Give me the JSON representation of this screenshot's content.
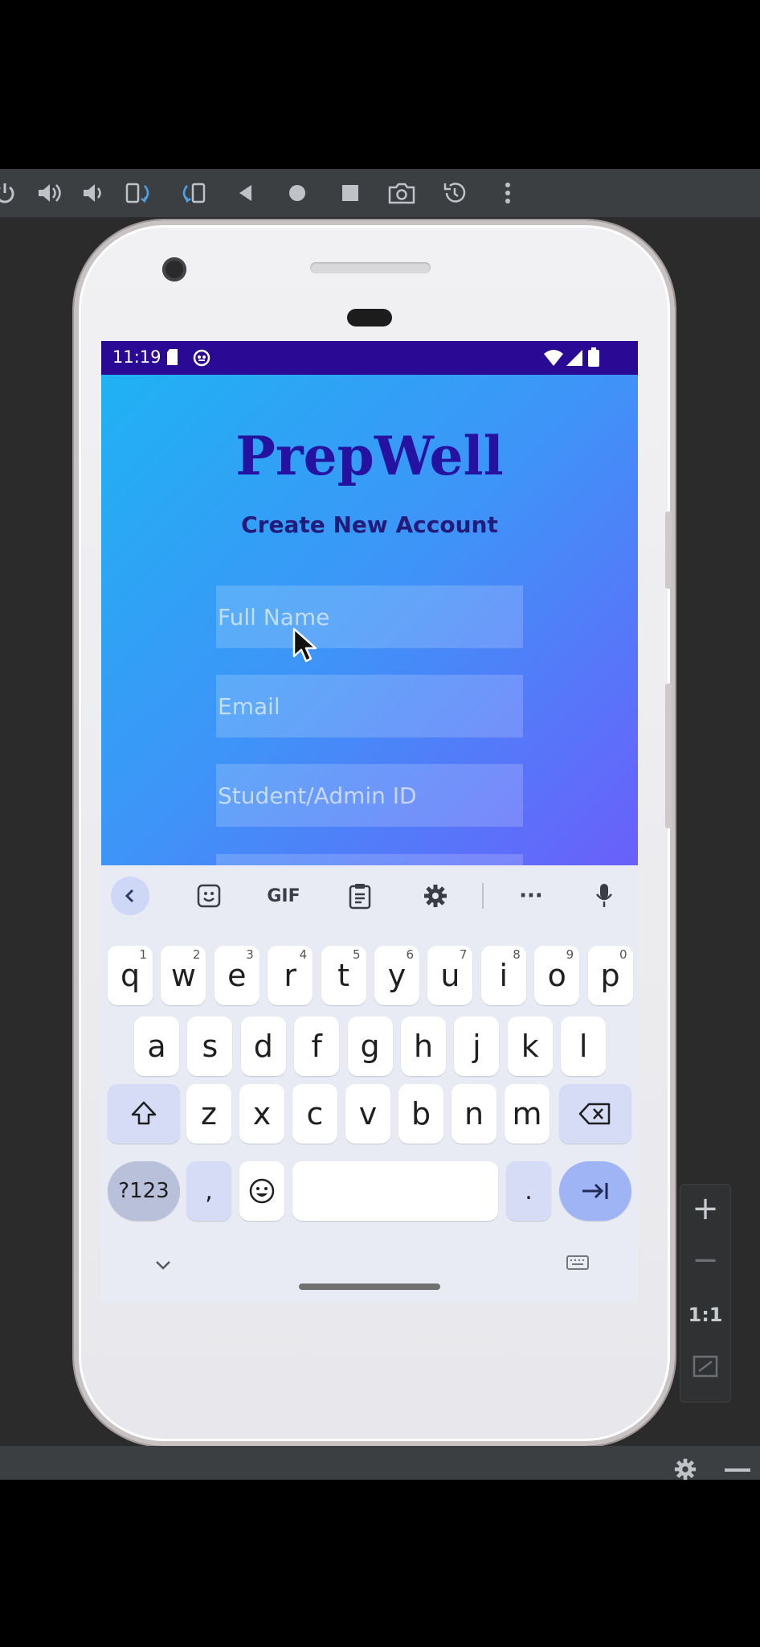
{
  "emulator": {
    "toolbar_icons": [
      "power-icon",
      "volume-up-icon",
      "volume-down-icon",
      "rotate-left-icon",
      "rotate-right-icon",
      "back-icon",
      "home-icon",
      "overview-icon",
      "screenshot-icon",
      "snapshot-icon",
      "more-icon"
    ],
    "zoom": {
      "plus": "+",
      "minus": "−",
      "one_to_one": "1:1"
    }
  },
  "status_bar": {
    "time": "11:19"
  },
  "app": {
    "title": "PrepWell",
    "subtitle": "Create New Account",
    "fields": [
      {
        "placeholder": "Full Name"
      },
      {
        "placeholder": "Email"
      },
      {
        "placeholder": "Student/Admin ID"
      }
    ]
  },
  "keyboard": {
    "toolbar": {
      "gif": "GIF",
      "more": "···"
    },
    "row1": [
      {
        "k": "q",
        "h": "1"
      },
      {
        "k": "w",
        "h": "2"
      },
      {
        "k": "e",
        "h": "3"
      },
      {
        "k": "r",
        "h": "4"
      },
      {
        "k": "t",
        "h": "5"
      },
      {
        "k": "y",
        "h": "6"
      },
      {
        "k": "u",
        "h": "7"
      },
      {
        "k": "i",
        "h": "8"
      },
      {
        "k": "o",
        "h": "9"
      },
      {
        "k": "p",
        "h": "0"
      }
    ],
    "row2": [
      "a",
      "s",
      "d",
      "f",
      "g",
      "h",
      "j",
      "k",
      "l"
    ],
    "row3": [
      "z",
      "x",
      "c",
      "v",
      "b",
      "n",
      "m"
    ],
    "symbols_label": "?123",
    "comma": ",",
    "period": "."
  },
  "colors": {
    "status_bar": "#2a0a95",
    "title": "#2612a0",
    "gradient_start": "#1fb2f3",
    "gradient_end": "#6a5ffa"
  }
}
